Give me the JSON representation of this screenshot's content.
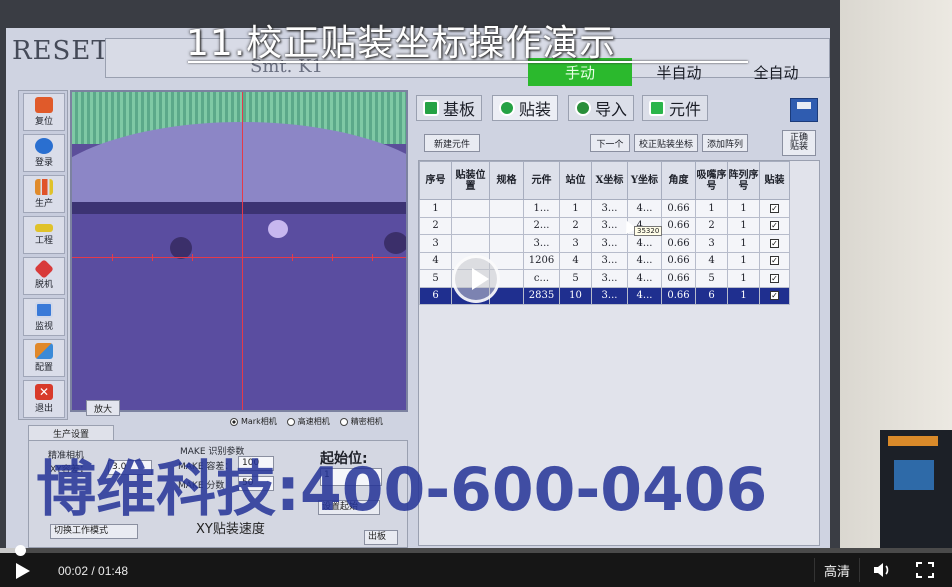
{
  "video": {
    "title": "11.校正贴装坐标操作演示",
    "watermark": "博维科技:400-600-0406"
  },
  "machine_ui": {
    "reset_label": "RESET",
    "model_label": "Smt. K1",
    "modes": [
      "手动",
      "半自动",
      "全自动"
    ],
    "sidebar": [
      {
        "label": "复位",
        "icon": "reset-icon",
        "color": "#e05a2a"
      },
      {
        "label": "登录",
        "icon": "login-icon",
        "color": "#2a6fd0"
      },
      {
        "label": "生产",
        "icon": "production-chart-icon",
        "color": "#e08a2a"
      },
      {
        "label": "工程",
        "icon": "engineering-icon",
        "color": "#e0c22a"
      },
      {
        "label": "脱机",
        "icon": "offline-icon",
        "color": "#d83a3a"
      },
      {
        "label": "监视",
        "icon": "monitor-icon",
        "color": "#3a7ad8"
      },
      {
        "label": "配置",
        "icon": "config-icon",
        "color": "#3a8ad8"
      },
      {
        "label": "退出",
        "icon": "exit-icon",
        "color": "#d83a2a"
      }
    ],
    "camera": {
      "zoom_label": "放大",
      "radio_options": [
        "Mark相机",
        "高速相机",
        "精密相机"
      ],
      "selected_radio": "Mark相机"
    },
    "production": {
      "tab_label": "生产设置",
      "precision_camera_label": "精准相机",
      "x_offset_label": "XY容差：",
      "x_offset_value": "3.0",
      "make_params_label": "MAKE 识别参数",
      "make_tol_label": "MAKE 容差：",
      "make_tol_value": "100",
      "make_score_label": "MAKE 分数",
      "make_score_value": "50",
      "start_label": "起始位:",
      "start_value": "1",
      "speed_label": "XY贴装速度",
      "set_start_button": "设置起始",
      "switch_button": "切换工作模式",
      "bottom_button": "出板"
    },
    "tabs": [
      {
        "label": "基板",
        "active": false
      },
      {
        "label": "贴装",
        "active": true
      },
      {
        "label": "导入",
        "active": false
      },
      {
        "label": "元件",
        "active": false
      }
    ],
    "toolbar": {
      "new_component": "新建元件",
      "next": "下一个",
      "calibrate": "校正贴装坐标",
      "add_array": "添加阵列",
      "right_button": "正确贴装"
    },
    "table": {
      "headers": [
        "序号",
        "贴装位置",
        "规格",
        "元件",
        "站位",
        "X坐标",
        "Y坐标",
        "角度",
        "吸嘴序号",
        "阵列序号",
        "贴装"
      ],
      "rows": [
        [
          "1",
          "",
          "",
          "1...",
          "1",
          "3...",
          "4...",
          "0.66",
          "1",
          "1",
          "☑"
        ],
        [
          "2",
          "",
          "",
          "2...",
          "2",
          "3...",
          "4...",
          "0.66",
          "2",
          "1",
          "☑"
        ],
        [
          "3",
          "",
          "",
          "3...",
          "3",
          "3...",
          "4...",
          "0.66",
          "3",
          "1",
          "☑"
        ],
        [
          "4",
          "",
          "",
          "1206",
          "4",
          "3...",
          "4...",
          "0.66",
          "4",
          "1",
          "☑"
        ],
        [
          "5",
          "",
          "",
          "c...",
          "5",
          "3...",
          "4...",
          "0.66",
          "5",
          "1",
          "☑"
        ],
        [
          "6",
          "",
          "",
          "2835",
          "10",
          "3...",
          "4...",
          "0.66",
          "6",
          "1",
          "☑"
        ]
      ],
      "selected_row_index": 5,
      "tooltip": "35320"
    }
  },
  "player": {
    "time": "00:02 / 01:48",
    "quality": "高清",
    "progress": 0.02
  }
}
